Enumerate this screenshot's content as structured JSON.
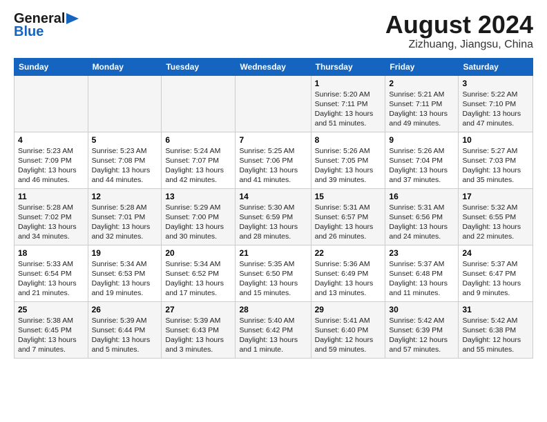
{
  "header": {
    "logo_general": "General",
    "logo_blue": "Blue",
    "title": "August 2024",
    "subtitle": "Zizhuang, Jiangsu, China"
  },
  "days_of_week": [
    "Sunday",
    "Monday",
    "Tuesday",
    "Wednesday",
    "Thursday",
    "Friday",
    "Saturday"
  ],
  "weeks": [
    [
      {
        "day": "",
        "info": ""
      },
      {
        "day": "",
        "info": ""
      },
      {
        "day": "",
        "info": ""
      },
      {
        "day": "",
        "info": ""
      },
      {
        "day": "1",
        "info": "Sunrise: 5:20 AM\nSunset: 7:11 PM\nDaylight: 13 hours\nand 51 minutes."
      },
      {
        "day": "2",
        "info": "Sunrise: 5:21 AM\nSunset: 7:11 PM\nDaylight: 13 hours\nand 49 minutes."
      },
      {
        "day": "3",
        "info": "Sunrise: 5:22 AM\nSunset: 7:10 PM\nDaylight: 13 hours\nand 47 minutes."
      }
    ],
    [
      {
        "day": "4",
        "info": "Sunrise: 5:23 AM\nSunset: 7:09 PM\nDaylight: 13 hours\nand 46 minutes."
      },
      {
        "day": "5",
        "info": "Sunrise: 5:23 AM\nSunset: 7:08 PM\nDaylight: 13 hours\nand 44 minutes."
      },
      {
        "day": "6",
        "info": "Sunrise: 5:24 AM\nSunset: 7:07 PM\nDaylight: 13 hours\nand 42 minutes."
      },
      {
        "day": "7",
        "info": "Sunrise: 5:25 AM\nSunset: 7:06 PM\nDaylight: 13 hours\nand 41 minutes."
      },
      {
        "day": "8",
        "info": "Sunrise: 5:26 AM\nSunset: 7:05 PM\nDaylight: 13 hours\nand 39 minutes."
      },
      {
        "day": "9",
        "info": "Sunrise: 5:26 AM\nSunset: 7:04 PM\nDaylight: 13 hours\nand 37 minutes."
      },
      {
        "day": "10",
        "info": "Sunrise: 5:27 AM\nSunset: 7:03 PM\nDaylight: 13 hours\nand 35 minutes."
      }
    ],
    [
      {
        "day": "11",
        "info": "Sunrise: 5:28 AM\nSunset: 7:02 PM\nDaylight: 13 hours\nand 34 minutes."
      },
      {
        "day": "12",
        "info": "Sunrise: 5:28 AM\nSunset: 7:01 PM\nDaylight: 13 hours\nand 32 minutes."
      },
      {
        "day": "13",
        "info": "Sunrise: 5:29 AM\nSunset: 7:00 PM\nDaylight: 13 hours\nand 30 minutes."
      },
      {
        "day": "14",
        "info": "Sunrise: 5:30 AM\nSunset: 6:59 PM\nDaylight: 13 hours\nand 28 minutes."
      },
      {
        "day": "15",
        "info": "Sunrise: 5:31 AM\nSunset: 6:57 PM\nDaylight: 13 hours\nand 26 minutes."
      },
      {
        "day": "16",
        "info": "Sunrise: 5:31 AM\nSunset: 6:56 PM\nDaylight: 13 hours\nand 24 minutes."
      },
      {
        "day": "17",
        "info": "Sunrise: 5:32 AM\nSunset: 6:55 PM\nDaylight: 13 hours\nand 22 minutes."
      }
    ],
    [
      {
        "day": "18",
        "info": "Sunrise: 5:33 AM\nSunset: 6:54 PM\nDaylight: 13 hours\nand 21 minutes."
      },
      {
        "day": "19",
        "info": "Sunrise: 5:34 AM\nSunset: 6:53 PM\nDaylight: 13 hours\nand 19 minutes."
      },
      {
        "day": "20",
        "info": "Sunrise: 5:34 AM\nSunset: 6:52 PM\nDaylight: 13 hours\nand 17 minutes."
      },
      {
        "day": "21",
        "info": "Sunrise: 5:35 AM\nSunset: 6:50 PM\nDaylight: 13 hours\nand 15 minutes."
      },
      {
        "day": "22",
        "info": "Sunrise: 5:36 AM\nSunset: 6:49 PM\nDaylight: 13 hours\nand 13 minutes."
      },
      {
        "day": "23",
        "info": "Sunrise: 5:37 AM\nSunset: 6:48 PM\nDaylight: 13 hours\nand 11 minutes."
      },
      {
        "day": "24",
        "info": "Sunrise: 5:37 AM\nSunset: 6:47 PM\nDaylight: 13 hours\nand 9 minutes."
      }
    ],
    [
      {
        "day": "25",
        "info": "Sunrise: 5:38 AM\nSunset: 6:45 PM\nDaylight: 13 hours\nand 7 minutes."
      },
      {
        "day": "26",
        "info": "Sunrise: 5:39 AM\nSunset: 6:44 PM\nDaylight: 13 hours\nand 5 minutes."
      },
      {
        "day": "27",
        "info": "Sunrise: 5:39 AM\nSunset: 6:43 PM\nDaylight: 13 hours\nand 3 minutes."
      },
      {
        "day": "28",
        "info": "Sunrise: 5:40 AM\nSunset: 6:42 PM\nDaylight: 13 hours\nand 1 minute."
      },
      {
        "day": "29",
        "info": "Sunrise: 5:41 AM\nSunset: 6:40 PM\nDaylight: 12 hours\nand 59 minutes."
      },
      {
        "day": "30",
        "info": "Sunrise: 5:42 AM\nSunset: 6:39 PM\nDaylight: 12 hours\nand 57 minutes."
      },
      {
        "day": "31",
        "info": "Sunrise: 5:42 AM\nSunset: 6:38 PM\nDaylight: 12 hours\nand 55 minutes."
      }
    ]
  ]
}
